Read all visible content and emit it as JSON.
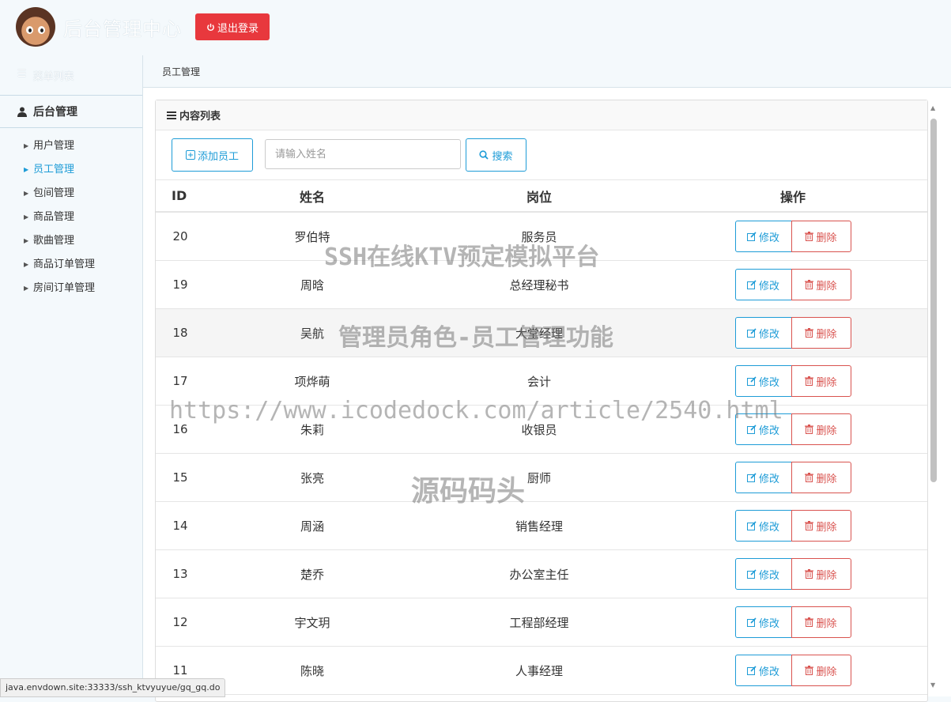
{
  "header": {
    "title": "后台管理中心",
    "logout_label": "退出登录"
  },
  "sidebar": {
    "menu_list_label": "菜单列表",
    "section_label": "后台管理",
    "items": [
      {
        "label": "用户管理",
        "active": false
      },
      {
        "label": "员工管理",
        "active": true
      },
      {
        "label": "包间管理",
        "active": false
      },
      {
        "label": "商品管理",
        "active": false
      },
      {
        "label": "歌曲管理",
        "active": false
      },
      {
        "label": "商品订单管理",
        "active": false
      },
      {
        "label": "房间订单管理",
        "active": false
      }
    ]
  },
  "breadcrumb": "员工管理",
  "panel": {
    "title": "内容列表",
    "add_label": "添加员工",
    "search_placeholder": "请输入姓名",
    "search_label": "搜索"
  },
  "table": {
    "columns": [
      "ID",
      "姓名",
      "岗位",
      "操作"
    ],
    "edit_label": "修改",
    "delete_label": "删除",
    "rows": [
      {
        "id": "20",
        "name": "罗伯特",
        "position": "服务员"
      },
      {
        "id": "19",
        "name": "周晗",
        "position": "总经理秘书"
      },
      {
        "id": "18",
        "name": "吴航",
        "position": "大堂经理"
      },
      {
        "id": "17",
        "name": "项烨萌",
        "position": "会计"
      },
      {
        "id": "16",
        "name": "朱莉",
        "position": "收银员"
      },
      {
        "id": "15",
        "name": "张亮",
        "position": "厨师"
      },
      {
        "id": "14",
        "name": "周涵",
        "position": "销售经理"
      },
      {
        "id": "13",
        "name": "楚乔",
        "position": "办公室主任"
      },
      {
        "id": "12",
        "name": "宇文玥",
        "position": "工程部经理"
      },
      {
        "id": "11",
        "name": "陈晓",
        "position": "人事经理"
      }
    ]
  },
  "statusbar": "java.envdown.site:33333/ssh_ktvyuyue/gq_gq.do",
  "watermarks": [
    "SSH在线KTV预定模拟平台",
    "管理员角色-员工管理功能",
    "https://www.icodedock.com/article/2540.html",
    "源码码头"
  ],
  "colors": {
    "accent": "#1e9cd7",
    "danger": "#d9534f",
    "logout_bg": "#e8383d",
    "background": "#f4f9fc"
  }
}
